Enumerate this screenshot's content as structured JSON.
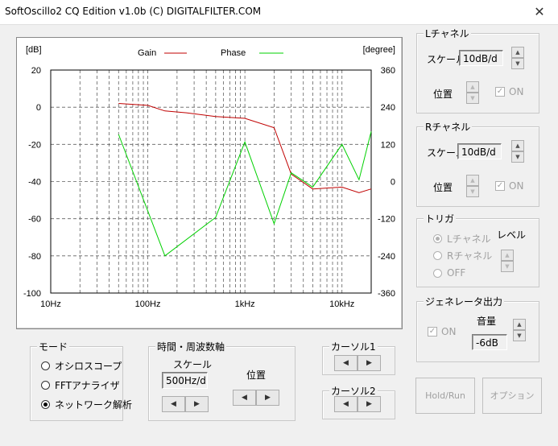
{
  "window": {
    "title": "SoftOscillo2 CQ Edition v1.0b (C) DIGITALFILTER.COM",
    "close_glyph": "✕"
  },
  "scope": {
    "left_unit": "[dB]",
    "right_unit": "[degree]",
    "legend_gain": "Gain",
    "legend_phase": "Phase",
    "left_ticks": [
      "20",
      "0",
      "-20",
      "-40",
      "-60",
      "-80",
      "-100"
    ],
    "right_ticks": [
      "360",
      "240",
      "120",
      "0",
      "-120",
      "-240",
      "-360"
    ],
    "x_ticks": [
      "10Hz",
      "100Hz",
      "1kHz",
      "10kHz"
    ],
    "colors": {
      "gain": "#c00000",
      "phase": "#00d000",
      "grid": "#606060",
      "border": "#000000"
    }
  },
  "chart_data": {
    "type": "line",
    "x_scale": "log",
    "x_range": [
      10,
      20000
    ],
    "y_left_range": [
      -100,
      20
    ],
    "y_right_range": [
      -360,
      360
    ],
    "grid": true,
    "legend": "top-center",
    "series": [
      {
        "name": "Gain",
        "axis": "left",
        "x": [
          50,
          100,
          150,
          250,
          500,
          1000,
          2000,
          3000,
          5000,
          10000,
          15000,
          20000
        ],
        "y": [
          2,
          1,
          -2,
          -3,
          -5,
          -6,
          -11,
          -36,
          -44,
          -43,
          -46,
          -44
        ]
      },
      {
        "name": "Phase",
        "axis": "right",
        "x": [
          50,
          150,
          500,
          1000,
          2000,
          3000,
          5000,
          10000,
          15000,
          20000
        ],
        "y": [
          152,
          -240,
          -116,
          128,
          -136,
          28,
          -18,
          120,
          6,
          162
        ]
      }
    ]
  },
  "lch": {
    "title": "Lチャネル",
    "scale_label": "スケール",
    "scale_value": "10dB/d",
    "pos_label": "位置",
    "on_label": "ON"
  },
  "rch": {
    "title": "Rチャネル",
    "scale_label": "スケール",
    "scale_value": "10dB/d",
    "pos_label": "位置",
    "on_label": "ON"
  },
  "trigger": {
    "title": "トリガ",
    "opt_l": "Lチャネル",
    "opt_r": "Rチャネル",
    "opt_off": "OFF",
    "level_label": "レベル"
  },
  "generator": {
    "title": "ジェネレータ出力",
    "on_label": "ON",
    "volume_label": "音量",
    "volume_value": "-6dB"
  },
  "mode": {
    "title": "モード",
    "opt_osc": "オシロスコープ",
    "opt_fft": "FFTアナライザ",
    "opt_net": "ネットワーク解析"
  },
  "time": {
    "title": "時間・周波数軸",
    "scale_label": "スケール",
    "scale_value": "500Hz/d",
    "pos_label": "位置"
  },
  "cursor1": {
    "title": "カーソル1"
  },
  "cursor2": {
    "title": "カーソル2"
  },
  "buttons": {
    "holdrun": "Hold/Run",
    "option": "オプション"
  },
  "glyphs": {
    "up": "▲",
    "down": "▼",
    "left": "◀",
    "right": "▶",
    "check": "✓"
  }
}
